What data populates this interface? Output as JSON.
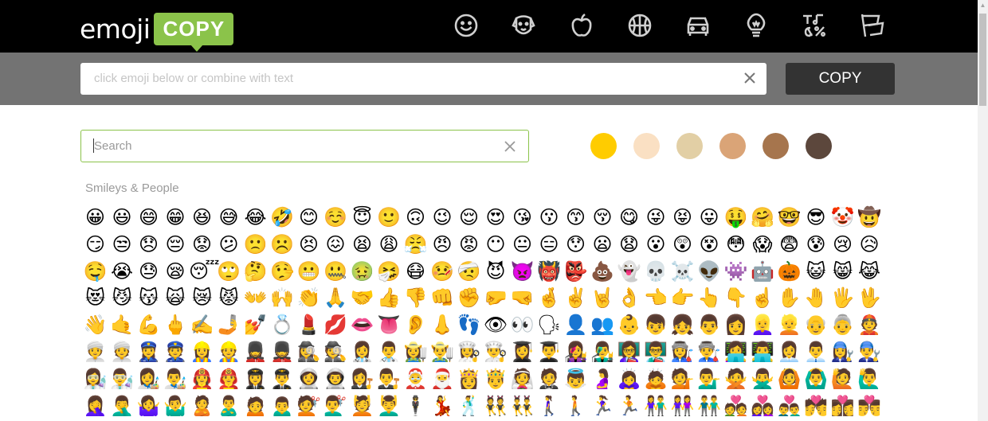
{
  "logo": {
    "word": "emoji",
    "box": "COPY"
  },
  "categories": [
    {
      "name": "smileys",
      "icon": "smiley-icon"
    },
    {
      "name": "animals",
      "icon": "dog-icon"
    },
    {
      "name": "food",
      "icon": "apple-icon"
    },
    {
      "name": "activity",
      "icon": "basketball-icon"
    },
    {
      "name": "travel",
      "icon": "car-icon"
    },
    {
      "name": "objects",
      "icon": "lightbulb-icon"
    },
    {
      "name": "symbols",
      "icon": "symbols-icon"
    },
    {
      "name": "flags",
      "icon": "flags-icon"
    }
  ],
  "copy_bar": {
    "placeholder": "click emoji below or combine with text",
    "button": "COPY"
  },
  "search": {
    "placeholder": "Search"
  },
  "skin_tones": [
    "#ffcc00",
    "#fae0c3",
    "#e2cfa5",
    "#daa477",
    "#a6754d",
    "#5c473c"
  ],
  "section": {
    "title": "Smileys & People"
  },
  "emoji_rows": [
    [
      "😀",
      "😃",
      "😄",
      "😁",
      "😆",
      "😅",
      "😂",
      "🤣",
      "😊",
      "☺️",
      "😇",
      "🙂",
      "🙃",
      "😉",
      "😌",
      "😍",
      "😘",
      "😗",
      "😙",
      "😚",
      "😋",
      "😜",
      "😝",
      "😛",
      "🤑",
      "🤗",
      "🤓",
      "😎",
      "🤡",
      "🤠"
    ],
    [
      "😏",
      "😒",
      "😞",
      "😔",
      "😟",
      "😕",
      "🙁",
      "☹️",
      "😣",
      "😖",
      "😫",
      "😩",
      "😤",
      "😠",
      "😡",
      "😶",
      "😐",
      "😑",
      "😯",
      "😦",
      "😧",
      "😮",
      "😲",
      "😵",
      "😳",
      "😱",
      "😨",
      "😰",
      "😢",
      "😥"
    ],
    [
      "🤤",
      "😭",
      "😓",
      "😪",
      "😴",
      "🙄",
      "🤔",
      "🤥",
      "😬",
      "🤐",
      "🤢",
      "🤧",
      "😷",
      "🤒",
      "🤕",
      "😈",
      "👿",
      "👹",
      "👺",
      "💩",
      "👻",
      "💀",
      "☠️",
      "👽",
      "👾",
      "🤖",
      "🎃",
      "😺",
      "😸",
      "😹"
    ],
    [
      "😻",
      "😼",
      "😽",
      "🙀",
      "😿",
      "😾",
      "👐",
      "🙌",
      "👏",
      "🙏",
      "🤝",
      "👍",
      "👎",
      "👊",
      "✊",
      "🤛",
      "🤜",
      "🤞",
      "✌️",
      "🤘",
      "👌",
      "👈",
      "👉",
      "👆",
      "👇",
      "☝️",
      "✋",
      "🤚",
      "🖐",
      "🖖"
    ],
    [
      "👋",
      "🤙",
      "💪",
      "🖕",
      "✍️",
      "🤳",
      "💅",
      "💍",
      "💄",
      "💋",
      "👄",
      "👅",
      "👂",
      "👃",
      "👣",
      "👁",
      "👀",
      "🗣",
      "👤",
      "👥",
      "👶",
      "👦",
      "👧",
      "👨",
      "👩",
      "👱‍♀️",
      "👱",
      "👴",
      "👵",
      "👲"
    ],
    [
      "👳‍♀️",
      "👳",
      "👮‍♀️",
      "👮",
      "👷‍♀️",
      "👷",
      "💂‍♀️",
      "💂",
      "🕵️‍♀️",
      "🕵️",
      "👩‍⚕️",
      "👨‍⚕️",
      "👩‍🌾",
      "👨‍🌾",
      "👩‍🍳",
      "👨‍🍳",
      "👩‍🎓",
      "👨‍🎓",
      "👩‍🎤",
      "👨‍🎤",
      "👩‍🏫",
      "👨‍🏫",
      "👩‍🏭",
      "👨‍🏭",
      "👩‍💻",
      "👨‍💻",
      "👩‍💼",
      "👨‍💼",
      "👩‍🔧",
      "👨‍🔧"
    ],
    [
      "👩‍🔬",
      "👨‍🔬",
      "👩‍🎨",
      "👨‍🎨",
      "👩‍🚒",
      "👨‍🚒",
      "👩‍✈️",
      "👨‍✈️",
      "👩‍🚀",
      "👨‍🚀",
      "👩‍⚖️",
      "👨‍⚖️",
      "🤶",
      "🎅",
      "👸",
      "🤴",
      "👰",
      "🤵",
      "👼",
      "🤰",
      "🙇‍♀️",
      "🙇",
      "💁",
      "💁‍♂️",
      "🙅",
      "🙅‍♂️",
      "🙆",
      "🙆‍♂️",
      "🙋",
      "🙋‍♂️"
    ],
    [
      "🤦‍♀️",
      "🤦‍♂️",
      "🤷‍♀️",
      "🤷‍♂️",
      "🙎",
      "🙎‍♂️",
      "🙍",
      "🙍‍♂️",
      "💇",
      "💇‍♂️",
      "💆",
      "💆‍♂️",
      "🕴",
      "💃",
      "🕺",
      "👯",
      "👯‍♂️",
      "🚶‍♀️",
      "🚶",
      "🏃‍♀️",
      "🏃",
      "👫",
      "👭",
      "👬",
      "💑",
      "👩‍❤️‍👩",
      "👨‍❤️‍👨",
      "💏",
      "👩‍❤️‍💋‍👩",
      "👨‍❤️‍💋‍👨"
    ]
  ]
}
